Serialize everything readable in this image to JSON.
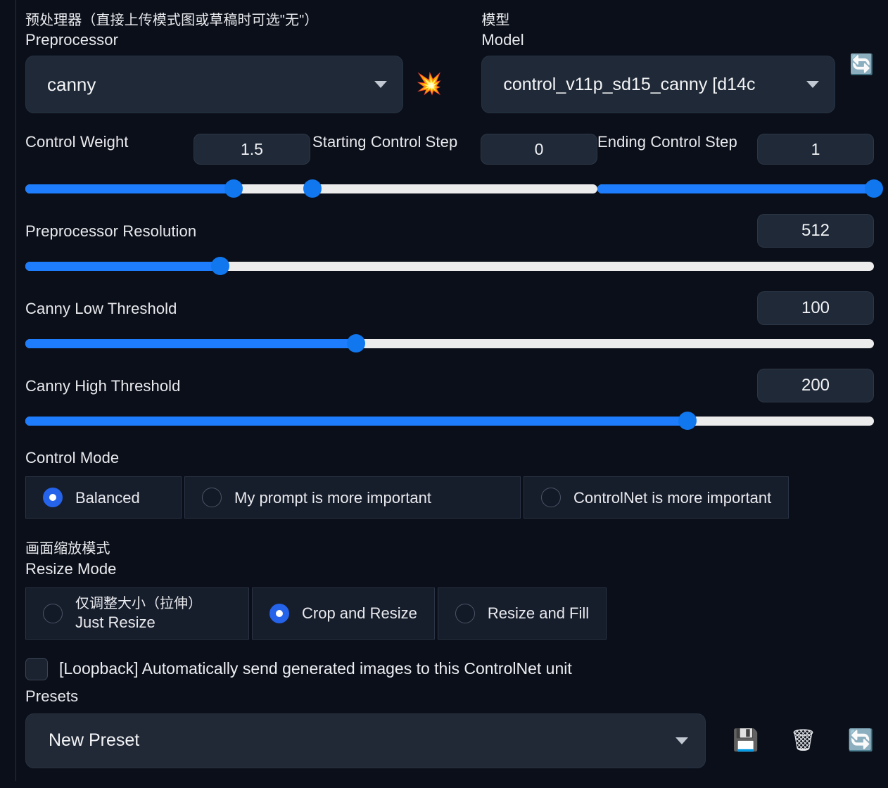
{
  "preprocessor": {
    "label_zh": "预处理器（直接上传模式图或草稿时可选\"无\"）",
    "label_en": "Preprocessor",
    "value": "canny",
    "run_icon": "💥"
  },
  "model": {
    "label_zh": "模型",
    "label_en": "Model",
    "value": "control_v11p_sd15_canny [d14c",
    "refresh_icon": "🔄"
  },
  "control_weight": {
    "label": "Control Weight",
    "value": "1.5",
    "fill_percent": 73
  },
  "starting_control_step": {
    "label": "Starting Control Step",
    "value": "0",
    "fill_percent": 0
  },
  "ending_control_step": {
    "label": "Ending Control Step",
    "value": "1",
    "fill_percent": 100
  },
  "preprocessor_resolution": {
    "label": "Preprocessor Resolution",
    "value": "512",
    "fill_percent": 23
  },
  "canny_low_threshold": {
    "label": "Canny Low Threshold",
    "value": "100",
    "fill_percent": 39
  },
  "canny_high_threshold": {
    "label": "Canny High Threshold",
    "value": "200",
    "fill_percent": 78
  },
  "control_mode": {
    "label": "Control Mode",
    "options": [
      {
        "label": "Balanced",
        "selected": true
      },
      {
        "label": "My prompt is more important",
        "selected": false
      },
      {
        "label": "ControlNet is more important",
        "selected": false
      }
    ]
  },
  "resize_mode": {
    "label_zh": "画面缩放模式",
    "label_en": "Resize Mode",
    "options": [
      {
        "label_zh": "仅调整大小（拉伸）",
        "label_en": "Just Resize",
        "selected": false
      },
      {
        "label_zh": "",
        "label_en": "Crop and Resize",
        "selected": true
      },
      {
        "label_zh": "",
        "label_en": "Resize and Fill",
        "selected": false
      }
    ]
  },
  "loopback": {
    "label": "[Loopback] Automatically send generated images to this ControlNet unit",
    "checked": false
  },
  "presets": {
    "label": "Presets",
    "value": "New Preset",
    "save_icon": "💾",
    "delete_icon": "🗑",
    "refresh_icon": "🔄"
  },
  "colors": {
    "background": "#0b0f19",
    "accent": "#1d7dfc",
    "track": "#ececec",
    "field": "#1f2937"
  }
}
